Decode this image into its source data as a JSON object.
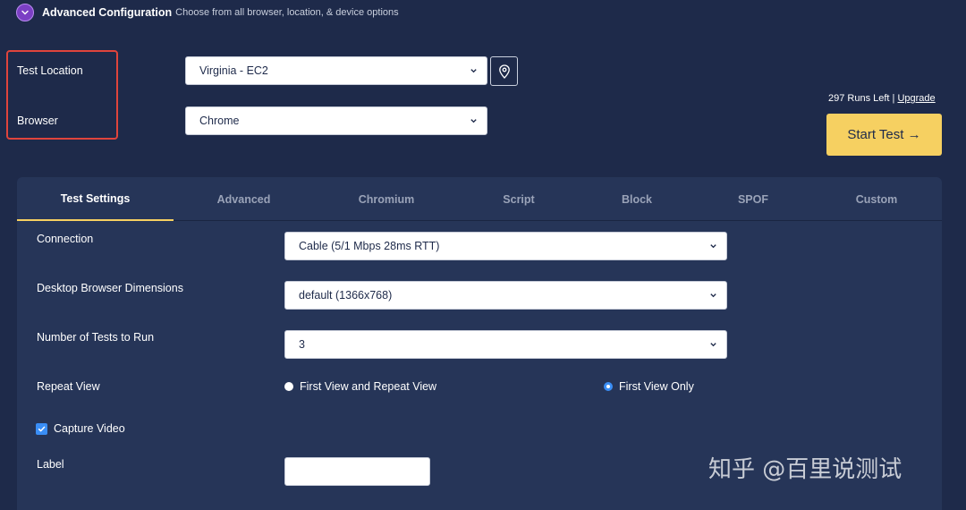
{
  "header": {
    "title": "Advanced Configuration",
    "subtitle": "Choose from all browser, location, & device options"
  },
  "test_location": {
    "label": "Test Location",
    "value": "Virginia - EC2"
  },
  "browser": {
    "label": "Browser",
    "value": "Chrome"
  },
  "runs": {
    "text": "297 Runs Left |",
    "upgrade_label": "Upgrade"
  },
  "start_button": {
    "label": "Start Test →"
  },
  "tabs": [
    {
      "label": "Test Settings",
      "active": true
    },
    {
      "label": "Advanced"
    },
    {
      "label": "Chromium"
    },
    {
      "label": "Script"
    },
    {
      "label": "Block"
    },
    {
      "label": "SPOF"
    },
    {
      "label": "Custom"
    }
  ],
  "settings": {
    "connection": {
      "label": "Connection",
      "value": "Cable (5/1 Mbps 28ms RTT)"
    },
    "dimensions": {
      "label": "Desktop Browser Dimensions",
      "value": "default (1366x768)"
    },
    "num_tests": {
      "label": "Number of Tests to Run",
      "value": "3"
    },
    "repeat_view": {
      "label": "Repeat View",
      "options": [
        "First View and Repeat View",
        "First View Only"
      ],
      "selected": "First View Only"
    },
    "capture_video": {
      "label": "Capture Video",
      "checked": true
    },
    "label_field": {
      "label": "Label",
      "value": ""
    }
  },
  "watermark": "知乎 @百里说测试",
  "colors": {
    "background": "#1e2a4a",
    "panel": "#263558",
    "accent_yellow": "#f6d061",
    "highlight_red": "#e0443c",
    "toggle_purple": "#7b3fc4",
    "radio_blue": "#3a8ef6"
  }
}
